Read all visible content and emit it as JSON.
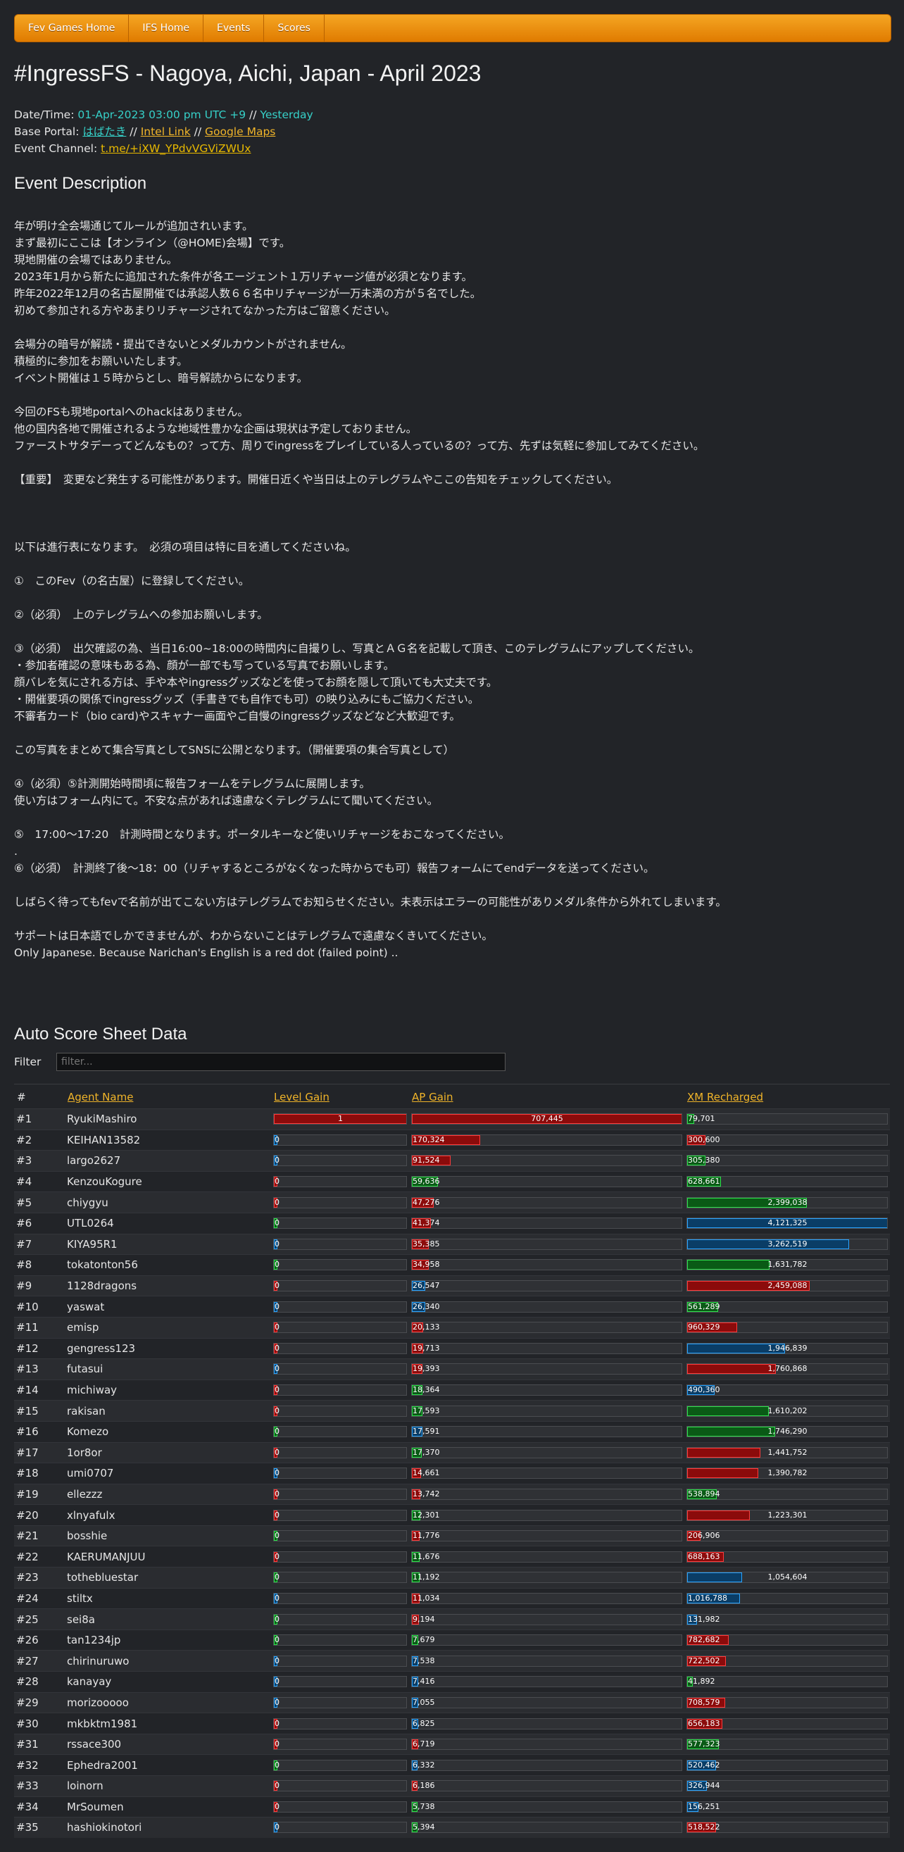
{
  "nav": [
    "Fev Games Home",
    "IFS Home",
    "Events",
    "Scores"
  ],
  "title": "#IngressFS - Nagoya, Aichi, Japan - April 2023",
  "meta": {
    "datetime_label": "Date/Time: ",
    "datetime_value": "01-Apr-2023 03:00 pm UTC +9",
    "datetime_sep": " // ",
    "datetime_rel": "Yesterday",
    "portal_label": "Base Portal: ",
    "portal_name": "はばたき",
    "sep": " // ",
    "intel": "Intel Link",
    "maps": "Google Maps",
    "channel_label": "Event Channel: ",
    "channel": "t.me/+iXW_YPdvVGViZWUx"
  },
  "desc_title": "Event Description",
  "description": "年が明け全会場通じてルールが追加されいます。\nまず最初にここは【オンライン（@HOME)会場】です。\n現地開催の会場ではありません。\n2023年1月から新たに追加された条件が各エージェント１万リチャージ値が必須となります。\n昨年2022年12月の名古屋開催では承認人数６６名中リチャージが一万未満の方が５名でした。\n初めて参加される方やあまりリチャージされてなかった方はご留意ください。\n\n会場分の暗号が解読・提出できないとメダルカウントがされません。\n積極的に参加をお願いいたします。\nイベント開催は１５時からとし、暗号解読からになります。\n\n今回のFSも現地portalへのhackはありません。\n他の国内各地で開催されるような地域性豊かな企画は現状は予定しておりません。\nファーストサタデーってどんなもの？って方、周りでingressをプレイしている人っているの？って方、先ずは気軽に参加してみてください。\n\n【重要】　変更など発生する可能性があります。開催日近くや当日は上のテレグラムやここの告知をチェックしてください。\n\n\n\n以下は進行表になります。　必須の項目は特に目を通してくださいね。\n\n①　このFev（の名古屋）に登録してください。\n\n②（必須）　上のテレグラムへの参加お願いします。\n\n③（必須）　出欠確認の為、当日16:00~18:00の時間内に自撮りし、写真とＡＧ名を記載して頂き、このテレグラムにアップしてください。\n・参加者確認の意味もある為、顔が一部でも写っている写真でお願いします。\n顔バレを気にされる方は、手や本やingressグッズなどを使ってお顔を隠して頂いても大丈夫です。\n・開催要項の関係でingressグッズ（手書きでも自作でも可）の映り込みにもご協力ください。\n不審者カード（bio card)やスキャナー画面やご自慢のingressグッズなどなど大歓迎です。\n\nこの写真をまとめて集合写真としてSNSに公開となります。（開催要項の集合写真として）\n\n④（必須）⑤計測開始時間頃に報告フォームをテレグラムに展開します。\n使い方はフォーム内にて。不安な点があれば遠慮なくテレグラムにて聞いてください。\n\n⑤　17:00～17:20　計測時間となります。ポータルキーなど使いリチャージをおこなってください。\n.\n⑥（必須）　計測終了後～18：00（リチャするところがなくなった時からでも可）報告フォームにてendデータを送ってください。\n\nしばらく待ってもfevで名前が出てこない方はテレグラムでお知らせください。未表示はエラーの可能性がありメダル条件から外れてしまいます。\n\nサポートは日本語でしかできませんが、わからないことはテレグラムで遠慮なくきいてください。\nOnly Japanese. Because Narichan's English is a red dot (failed point) ..",
  "score_title": "Auto Score Sheet Data",
  "filter": {
    "label": "Filter",
    "placeholder": "filter..."
  },
  "table_headers": [
    "#",
    "Agent Name",
    "Level Gain",
    "AP Gain",
    "XM Recharged"
  ],
  "colors": {
    "red": "#8b0b0b",
    "green": "#0a5a16",
    "blue": "#0a3d66",
    "accent": "#f0b429"
  },
  "max": {
    "level": 1,
    "ap": 707445,
    "xm": 4121325
  },
  "rows": [
    {
      "rank": "#1",
      "name": "RyukiMashiro",
      "level": "1",
      "level_v": 1,
      "level_c": "red",
      "ap": "707,445",
      "ap_v": 707445,
      "ap_c": "red",
      "xm": "79,701",
      "xm_v": 79701,
      "xm_c": "green"
    },
    {
      "rank": "#2",
      "name": "KEIHAN13582",
      "level": "0",
      "level_v": 0,
      "level_c": "blue",
      "ap": "170,324",
      "ap_v": 170324,
      "ap_c": "red",
      "xm": "300,600",
      "xm_v": 300600,
      "xm_c": "red"
    },
    {
      "rank": "#3",
      "name": "largo2627",
      "level": "0",
      "level_v": 0,
      "level_c": "blue",
      "ap": "91,524",
      "ap_v": 91524,
      "ap_c": "red",
      "xm": "305,380",
      "xm_v": 305380,
      "xm_c": "green"
    },
    {
      "rank": "#4",
      "name": "KenzouKogure",
      "level": "0",
      "level_v": 0,
      "level_c": "red",
      "ap": "59,636",
      "ap_v": 59636,
      "ap_c": "green",
      "xm": "628,661",
      "xm_v": 628661,
      "xm_c": "green"
    },
    {
      "rank": "#5",
      "name": "chiygyu",
      "level": "0",
      "level_v": 0,
      "level_c": "red",
      "ap": "47,276",
      "ap_v": 47276,
      "ap_c": "red",
      "xm": "2,399,038",
      "xm_v": 2399038,
      "xm_c": "green"
    },
    {
      "rank": "#6",
      "name": "UTL0264",
      "level": "0",
      "level_v": 0,
      "level_c": "green",
      "ap": "41,374",
      "ap_v": 41374,
      "ap_c": "red",
      "xm": "4,121,325",
      "xm_v": 4121325,
      "xm_c": "blue"
    },
    {
      "rank": "#7",
      "name": "KIYA95R1",
      "level": "0",
      "level_v": 0,
      "level_c": "blue",
      "ap": "35,385",
      "ap_v": 35385,
      "ap_c": "red",
      "xm": "3,262,519",
      "xm_v": 3262519,
      "xm_c": "blue"
    },
    {
      "rank": "#8",
      "name": "tokatonton56",
      "level": "0",
      "level_v": 0,
      "level_c": "green",
      "ap": "34,958",
      "ap_v": 34958,
      "ap_c": "red",
      "xm": "1,631,782",
      "xm_v": 1631782,
      "xm_c": "green"
    },
    {
      "rank": "#9",
      "name": "1128dragons",
      "level": "0",
      "level_v": 0,
      "level_c": "red",
      "ap": "26,547",
      "ap_v": 26547,
      "ap_c": "blue",
      "xm": "2,459,088",
      "xm_v": 2459088,
      "xm_c": "red"
    },
    {
      "rank": "#10",
      "name": "yaswat",
      "level": "0",
      "level_v": 0,
      "level_c": "blue",
      "ap": "26,340",
      "ap_v": 26340,
      "ap_c": "blue",
      "xm": "561,289",
      "xm_v": 561289,
      "xm_c": "green"
    },
    {
      "rank": "#11",
      "name": "emisp",
      "level": "0",
      "level_v": 0,
      "level_c": "red",
      "ap": "20,133",
      "ap_v": 20133,
      "ap_c": "red",
      "xm": "960,329",
      "xm_v": 960329,
      "xm_c": "red"
    },
    {
      "rank": "#12",
      "name": "gengress123",
      "level": "0",
      "level_v": 0,
      "level_c": "red",
      "ap": "19,713",
      "ap_v": 19713,
      "ap_c": "red",
      "xm": "1,946,839",
      "xm_v": 1946839,
      "xm_c": "blue"
    },
    {
      "rank": "#13",
      "name": "futasui",
      "level": "0",
      "level_v": 0,
      "level_c": "blue",
      "ap": "19,393",
      "ap_v": 19393,
      "ap_c": "red",
      "xm": "1,760,868",
      "xm_v": 1760868,
      "xm_c": "red"
    },
    {
      "rank": "#14",
      "name": "michiway",
      "level": "0",
      "level_v": 0,
      "level_c": "red",
      "ap": "18,364",
      "ap_v": 18364,
      "ap_c": "green",
      "xm": "490,360",
      "xm_v": 490360,
      "xm_c": "blue"
    },
    {
      "rank": "#15",
      "name": "rakisan",
      "level": "0",
      "level_v": 0,
      "level_c": "red",
      "ap": "17,593",
      "ap_v": 17593,
      "ap_c": "green",
      "xm": "1,610,202",
      "xm_v": 1610202,
      "xm_c": "green"
    },
    {
      "rank": "#16",
      "name": "Komezo",
      "level": "0",
      "level_v": 0,
      "level_c": "green",
      "ap": "17,591",
      "ap_v": 17591,
      "ap_c": "blue",
      "xm": "1,746,290",
      "xm_v": 1746290,
      "xm_c": "green"
    },
    {
      "rank": "#17",
      "name": "1or8or",
      "level": "0",
      "level_v": 0,
      "level_c": "red",
      "ap": "17,370",
      "ap_v": 17370,
      "ap_c": "green",
      "xm": "1,441,752",
      "xm_v": 1441752,
      "xm_c": "red"
    },
    {
      "rank": "#18",
      "name": "umi0707",
      "level": "0",
      "level_v": 0,
      "level_c": "blue",
      "ap": "14,661",
      "ap_v": 14661,
      "ap_c": "red",
      "xm": "1,390,782",
      "xm_v": 1390782,
      "xm_c": "red"
    },
    {
      "rank": "#19",
      "name": "ellezzz",
      "level": "0",
      "level_v": 0,
      "level_c": "red",
      "ap": "13,742",
      "ap_v": 13742,
      "ap_c": "red",
      "xm": "538,894",
      "xm_v": 538894,
      "xm_c": "green"
    },
    {
      "rank": "#20",
      "name": "xlnyafulx",
      "level": "0",
      "level_v": 0,
      "level_c": "red",
      "ap": "12,301",
      "ap_v": 12301,
      "ap_c": "green",
      "xm": "1,223,301",
      "xm_v": 1223301,
      "xm_c": "red"
    },
    {
      "rank": "#21",
      "name": "bosshie",
      "level": "0",
      "level_v": 0,
      "level_c": "green",
      "ap": "11,776",
      "ap_v": 11776,
      "ap_c": "red",
      "xm": "206,906",
      "xm_v": 206906,
      "xm_c": "red"
    },
    {
      "rank": "#22",
      "name": "KAERUMANJUU",
      "level": "0",
      "level_v": 0,
      "level_c": "red",
      "ap": "11,676",
      "ap_v": 11676,
      "ap_c": "green",
      "xm": "688,163",
      "xm_v": 688163,
      "xm_c": "red"
    },
    {
      "rank": "#23",
      "name": "tothebluestar",
      "level": "0",
      "level_v": 0,
      "level_c": "green",
      "ap": "11,192",
      "ap_v": 11192,
      "ap_c": "green",
      "xm": "1,054,604",
      "xm_v": 1054604,
      "xm_c": "blue"
    },
    {
      "rank": "#24",
      "name": "stiltx",
      "level": "0",
      "level_v": 0,
      "level_c": "blue",
      "ap": "11,034",
      "ap_v": 11034,
      "ap_c": "red",
      "xm": "1,016,788",
      "xm_v": 1016788,
      "xm_c": "blue"
    },
    {
      "rank": "#25",
      "name": "sei8a",
      "level": "0",
      "level_v": 0,
      "level_c": "green",
      "ap": "9,194",
      "ap_v": 9194,
      "ap_c": "red",
      "xm": "131,982",
      "xm_v": 131982,
      "xm_c": "blue"
    },
    {
      "rank": "#26",
      "name": "tan1234jp",
      "level": "0",
      "level_v": 0,
      "level_c": "green",
      "ap": "7,679",
      "ap_v": 7679,
      "ap_c": "green",
      "xm": "782,682",
      "xm_v": 782682,
      "xm_c": "red"
    },
    {
      "rank": "#27",
      "name": "chirinuruwo",
      "level": "0",
      "level_v": 0,
      "level_c": "blue",
      "ap": "7,538",
      "ap_v": 7538,
      "ap_c": "blue",
      "xm": "722,502",
      "xm_v": 722502,
      "xm_c": "red"
    },
    {
      "rank": "#28",
      "name": "kanayay",
      "level": "0",
      "level_v": 0,
      "level_c": "blue",
      "ap": "7,416",
      "ap_v": 7416,
      "ap_c": "blue",
      "xm": "41,892",
      "xm_v": 41892,
      "xm_c": "green"
    },
    {
      "rank": "#29",
      "name": "morizooooo",
      "level": "0",
      "level_v": 0,
      "level_c": "blue",
      "ap": "7,055",
      "ap_v": 7055,
      "ap_c": "blue",
      "xm": "708,579",
      "xm_v": 708579,
      "xm_c": "red"
    },
    {
      "rank": "#30",
      "name": "mkbktm1981",
      "level": "0",
      "level_v": 0,
      "level_c": "red",
      "ap": "6,825",
      "ap_v": 6825,
      "ap_c": "blue",
      "xm": "656,183",
      "xm_v": 656183,
      "xm_c": "red"
    },
    {
      "rank": "#31",
      "name": "rssace300",
      "level": "0",
      "level_v": 0,
      "level_c": "red",
      "ap": "6,719",
      "ap_v": 6719,
      "ap_c": "red",
      "xm": "577,323",
      "xm_v": 577323,
      "xm_c": "green"
    },
    {
      "rank": "#32",
      "name": "Ephedra2001",
      "level": "0",
      "level_v": 0,
      "level_c": "green",
      "ap": "6,332",
      "ap_v": 6332,
      "ap_c": "blue",
      "xm": "520,462",
      "xm_v": 520462,
      "xm_c": "blue"
    },
    {
      "rank": "#33",
      "name": "loinorn",
      "level": "0",
      "level_v": 0,
      "level_c": "red",
      "ap": "6,186",
      "ap_v": 6186,
      "ap_c": "red",
      "xm": "326,944",
      "xm_v": 326944,
      "xm_c": "blue"
    },
    {
      "rank": "#34",
      "name": "MrSoumen",
      "level": "0",
      "level_v": 0,
      "level_c": "red",
      "ap": "5,738",
      "ap_v": 5738,
      "ap_c": "green",
      "xm": "156,251",
      "xm_v": 156251,
      "xm_c": "blue"
    },
    {
      "rank": "#35",
      "name": "hashiokinotori",
      "level": "0",
      "level_v": 0,
      "level_c": "blue",
      "ap": "5,394",
      "ap_v": 5394,
      "ap_c": "green",
      "xm": "518,522",
      "xm_v": 518522,
      "xm_c": "red"
    }
  ]
}
